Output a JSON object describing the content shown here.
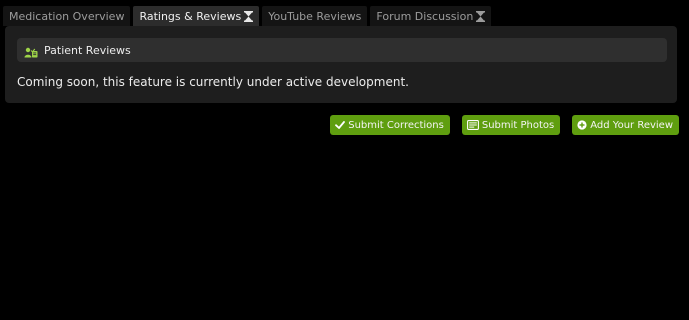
{
  "tabs": [
    {
      "label": "Medication Overview",
      "active": false,
      "icon": null
    },
    {
      "label": "Ratings & Reviews",
      "active": true,
      "icon": "hourglass-icon"
    },
    {
      "label": "YouTube Reviews",
      "active": false,
      "icon": null
    },
    {
      "label": "Forum Discussion",
      "active": false,
      "icon": "hourglass-icon"
    }
  ],
  "panel": {
    "header_icon": "patient-reviews-icon",
    "header_title": "Patient Reviews",
    "message": "Coming soon, this feature is currently under active development."
  },
  "actions": {
    "submit_corrections": {
      "label": "Submit Corrections",
      "icon": "check-icon"
    },
    "submit_photos": {
      "label": "Submit Photos",
      "icon": "photo-icon"
    },
    "add_review": {
      "label": "Add Your Review",
      "icon": "plus-circle-icon"
    }
  },
  "colors": {
    "background": "#000000",
    "panel": "#1e1e1e",
    "panel_header": "#2f2f2f",
    "accent_green": "#5f9e0f",
    "icon_green": "#9ed448"
  }
}
